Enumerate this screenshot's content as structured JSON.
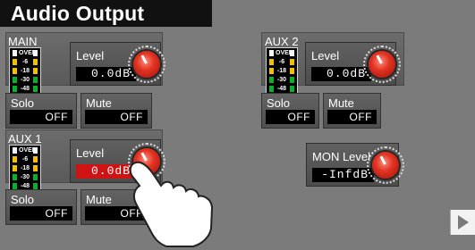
{
  "title": "Audio Output",
  "main": {
    "label": "MAIN",
    "meter": [
      "OVER",
      "-6",
      "-18",
      "-30",
      "-48"
    ],
    "level_label": "Level",
    "level_value": "0.0dB",
    "solo_label": "Solo",
    "solo_value": "OFF",
    "mute_label": "Mute",
    "mute_value": "OFF"
  },
  "aux1": {
    "label": "AUX 1",
    "meter": [
      "OVER",
      "-6",
      "-18",
      "-30",
      "-48"
    ],
    "level_label": "Level",
    "level_value": "0.0dB",
    "solo_label": "Solo",
    "solo_value": "OFF",
    "mute_label": "Mute",
    "mute_value": "OFF"
  },
  "aux2": {
    "label": "AUX 2",
    "meter": [
      "OVER",
      "-6",
      "-18",
      "-30",
      "-48"
    ],
    "level_label": "Level",
    "level_value": "0.0dB",
    "solo_label": "Solo",
    "solo_value": "OFF",
    "mute_label": "Mute",
    "mute_value": "OFF"
  },
  "mon": {
    "level_label": "MON Level",
    "level_value": "-InfdB"
  },
  "icons": {
    "play": "play-icon",
    "knob": "knob-icon"
  },
  "colors": {
    "background": "#7b7b7b",
    "title_bar": "#111111",
    "active_value": "#cf1313",
    "knob_red": "#e23322"
  }
}
